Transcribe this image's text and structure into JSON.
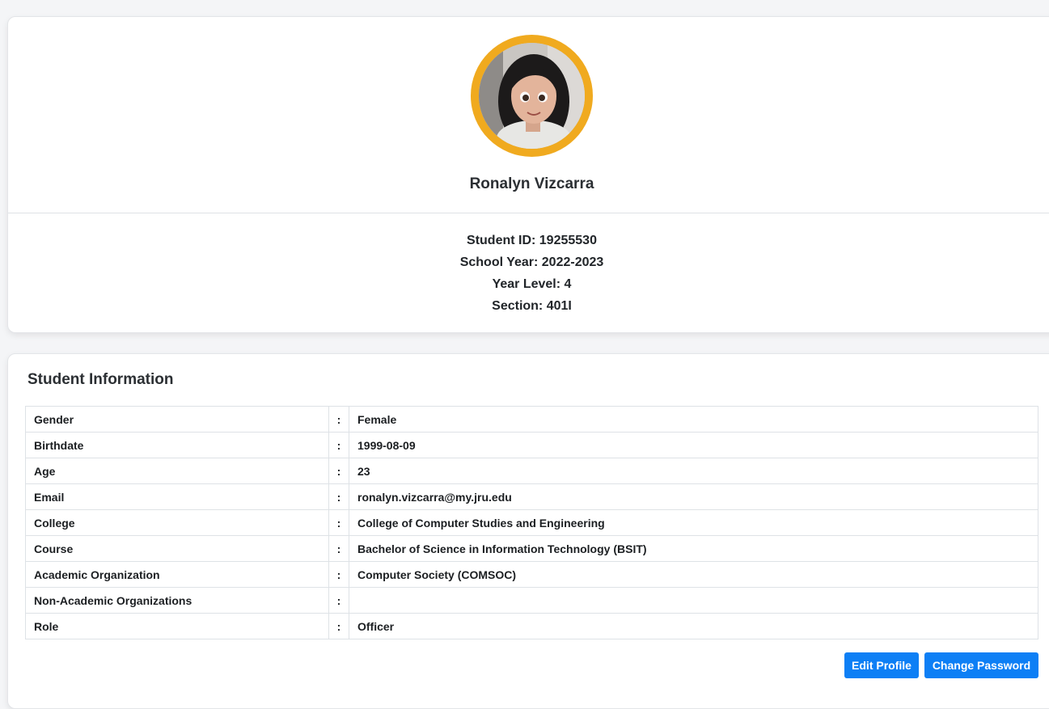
{
  "profile": {
    "name": "Ronalyn Vizcarra",
    "student_id": "Student ID: 19255530",
    "school_year": "School Year: 2022-2023",
    "year_level": "Year Level: 4",
    "section": "Section: 401I",
    "avatar_ring_color": "#f0aa1f"
  },
  "info": {
    "title": "Student Information",
    "separator": ":",
    "rows": [
      {
        "label": "Gender",
        "value": "Female"
      },
      {
        "label": "Birthdate",
        "value": "1999-08-09"
      },
      {
        "label": "Age",
        "value": "23"
      },
      {
        "label": "Email",
        "value": "ronalyn.vizcarra@my.jru.edu"
      },
      {
        "label": "College",
        "value": "College of Computer Studies and Engineering"
      },
      {
        "label": "Course",
        "value": "Bachelor of Science in Information Technology (BSIT)"
      },
      {
        "label": "Academic Organization",
        "value": "Computer Society (COMSOC)"
      },
      {
        "label": "Non-Academic Organizations",
        "value": ""
      },
      {
        "label": "Role",
        "value": "Officer"
      }
    ]
  },
  "actions": {
    "edit_label": "Edit Profile",
    "password_label": "Change Password",
    "button_color": "#0d7ff5"
  }
}
